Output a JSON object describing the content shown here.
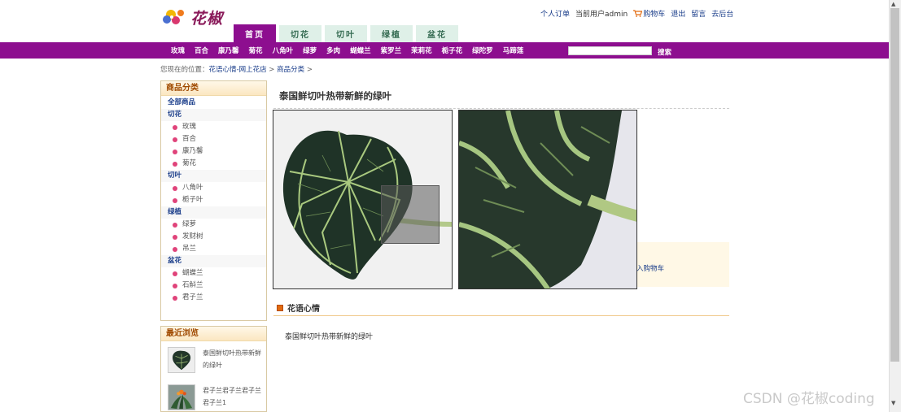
{
  "header": {
    "logo_text": "花椒",
    "toplinks": {
      "orders": "个人订单",
      "current_user": "当前用户admin",
      "cart": "购物车",
      "logout": "退出",
      "message": "留言",
      "admin": "去后台"
    }
  },
  "tabs": [
    {
      "label": "首页",
      "active": true
    },
    {
      "label": "切花",
      "active": false
    },
    {
      "label": "切叶",
      "active": false
    },
    {
      "label": "绿植",
      "active": false
    },
    {
      "label": "盆花",
      "active": false
    }
  ],
  "nav": {
    "items": [
      "玫瑰",
      "百合",
      "康乃馨",
      "菊花",
      "八角叶",
      "绿萝",
      "多肉",
      "蝴蝶兰",
      "紫罗兰",
      "茉莉花",
      "栀子花",
      "绿陀罗",
      "马蹄莲"
    ],
    "search_placeholder": "",
    "search_button": "搜索"
  },
  "breadcrumb": {
    "prefix": "您现在的位置：",
    "home": "花语心情-网上花店",
    "sep1": " > ",
    "category": "商品分类",
    "sep2": " >"
  },
  "sidebar": {
    "title": "商品分类",
    "all": "全部商品",
    "groups": [
      {
        "name": "切花",
        "items": [
          "玫瑰",
          "百合",
          "康乃馨",
          "菊花"
        ]
      },
      {
        "name": "切叶",
        "items": [
          "八角叶",
          "栀子叶"
        ]
      },
      {
        "name": "绿植",
        "items": [
          "绿萝",
          "发财树",
          "吊兰"
        ]
      },
      {
        "name": "盆花",
        "items": [
          "蝴蝶兰",
          "石斛兰",
          "君子兰"
        ]
      }
    ]
  },
  "recent": {
    "title": "最近浏览",
    "items": [
      {
        "name": "泰国鲜切叶热带新鲜的绿叶",
        "thumb": "leaf"
      },
      {
        "name": "君子兰君子兰君子兰君子兰1",
        "thumb": "orchid"
      }
    ]
  },
  "product": {
    "title": "泰国鲜切叶热带新鲜的绿叶",
    "cart_button": "入购物车",
    "section_title": "花语心情",
    "description": "泰国鲜切叶热带新鲜的绿叶"
  },
  "watermark": "CSDN @花椒coding",
  "colors": {
    "nav_purple": "#8d0e8f",
    "tab_green": "#dff0e8",
    "link_blue": "#1a3d8a",
    "bullet_pink": "#e0437a"
  }
}
